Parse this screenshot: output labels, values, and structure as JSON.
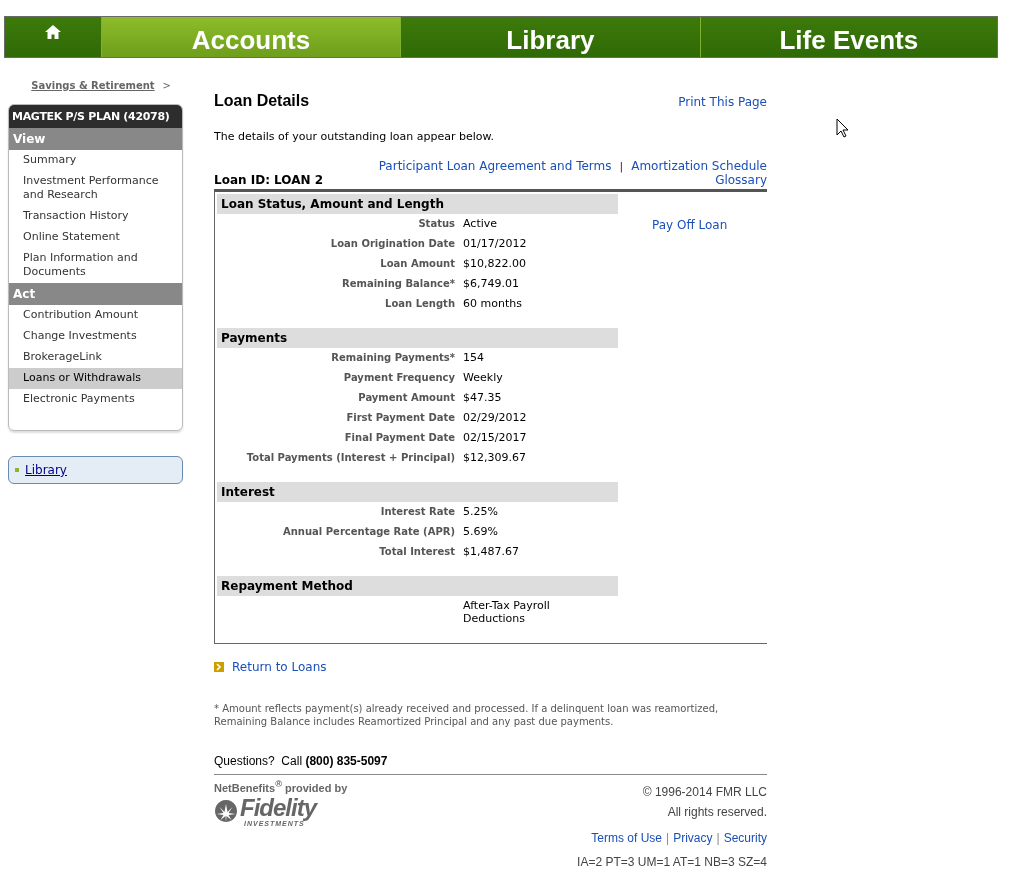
{
  "nav": {
    "tabs": [
      {
        "kind": "home",
        "selected": false
      },
      {
        "kind": "text",
        "label": "Accounts",
        "selected": true
      },
      {
        "kind": "text",
        "label": "Library",
        "selected": false
      },
      {
        "kind": "text",
        "label": "Life Events",
        "selected": false
      }
    ]
  },
  "breadcrumb": {
    "link": "Savings & Retirement",
    "separator": ">"
  },
  "sidebar": {
    "title": "MAGTEK P/S PLAN (42078)",
    "groups": [
      {
        "heading": "View",
        "items": [
          {
            "label": "Summary",
            "selected": false
          },
          {
            "label": "Investment Performance and Research",
            "selected": false
          },
          {
            "label": "Transaction History",
            "selected": false
          },
          {
            "label": "Online Statement",
            "selected": false
          },
          {
            "label": "Plan Information and Documents",
            "selected": false
          }
        ]
      },
      {
        "heading": "Act",
        "items": [
          {
            "label": "Contribution Amount",
            "selected": false
          },
          {
            "label": "Change Investments",
            "selected": false
          },
          {
            "label": "BrokerageLink",
            "selected": false
          },
          {
            "label": "Loans or Withdrawals",
            "selected": true
          },
          {
            "label": "Electronic Payments",
            "selected": false
          }
        ]
      }
    ],
    "library_link": "Library"
  },
  "page": {
    "title": "Loan Details",
    "print_link": "Print This Page",
    "intro": "The details of your outstanding loan appear below.",
    "links": [
      "Participant Loan Agreement and Terms",
      "Amortization Schedule"
    ],
    "link_separator": "|",
    "glossary_link": "Glossary",
    "loan_id": "Loan ID: LOAN 2",
    "action_link": "Pay Off Loan",
    "sections": [
      {
        "title": "Loan Status, Amount and Length",
        "rows": [
          {
            "label": "Status",
            "value": "Active"
          },
          {
            "label": "Loan Origination Date",
            "value": "01/17/2012"
          },
          {
            "label": "Loan Amount",
            "value": "$10,822.00"
          },
          {
            "label": "Remaining Balance*",
            "value": "$6,749.01"
          },
          {
            "label": "Loan Length",
            "value": "60 months"
          }
        ]
      },
      {
        "title": "Payments",
        "rows": [
          {
            "label": "Remaining Payments*",
            "value": "154"
          },
          {
            "label": "Payment Frequency",
            "value": "Weekly"
          },
          {
            "label": "Payment Amount",
            "value": "$47.35"
          },
          {
            "label": "First Payment Date",
            "value": "02/29/2012"
          },
          {
            "label": "Final Payment Date",
            "value": "02/15/2017"
          },
          {
            "label": "Total Payments (Interest + Principal)",
            "value": "$12,309.67"
          }
        ]
      },
      {
        "title": "Interest",
        "rows": [
          {
            "label": "Interest Rate",
            "value": "5.25%"
          },
          {
            "label": "Annual Percentage Rate (APR)",
            "value": "5.69%"
          },
          {
            "label": "Total Interest",
            "value": "$1,487.67"
          }
        ]
      },
      {
        "title": "Repayment Method",
        "rows": [
          {
            "value": "After-Tax Payroll Deductions"
          }
        ]
      }
    ],
    "return_link": "Return to Loans",
    "footnote": "* Amount reflects payment(s) already received and processed. If a delinquent loan was reamortized, Remaining Balance includes Reamortized Principal and any past due payments.",
    "questions": "Questions?  Call **(800) 835-5097**"
  },
  "footer": {
    "provided_by": "NetBenefits$^{®}$ provided by",
    "logo_name": "Fidelity",
    "logo_sub": "INVESTMENTS",
    "copyright": "© 1996-2014 FMR LLC",
    "rights": "All rights reserved.",
    "links": [
      "Terms of Use",
      "Privacy",
      "Security"
    ],
    "link_separator": "|",
    "codes": "IA=2 PT=3 UM=1 AT=1 NB=3 SZ=4"
  }
}
